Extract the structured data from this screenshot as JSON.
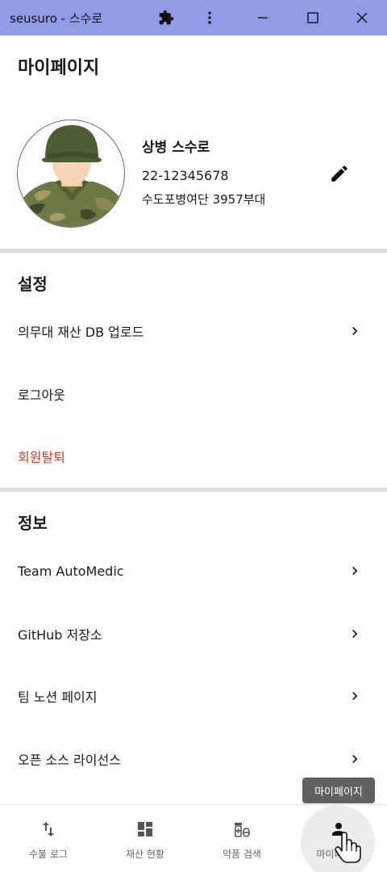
{
  "window": {
    "title": "seusuro - 스수로",
    "icons": [
      "extensions-icon",
      "more-vert-icon",
      "minimize-icon",
      "maximize-icon",
      "close-icon"
    ]
  },
  "page": {
    "title": "마이페이지"
  },
  "profile": {
    "rank_name": "상병 스수로",
    "serial": "22-12345678",
    "unit": "수도포병여단 3957부대"
  },
  "settings": {
    "title": "설정",
    "items": [
      {
        "label": "의무대 재산 DB 업로드",
        "chevron": true
      },
      {
        "label": "로그아웃",
        "chevron": false
      },
      {
        "label": "회원탈퇴",
        "chevron": false,
        "color": "#d33a2c"
      }
    ]
  },
  "info": {
    "title": "정보",
    "items": [
      {
        "label": "Team AutoMedic",
        "chevron": true
      },
      {
        "label": "GitHub 저장소",
        "chevron": true
      },
      {
        "label": "팀 노션 페이지",
        "chevron": true
      },
      {
        "label": "오픈 소스 라이선스",
        "chevron": true
      }
    ]
  },
  "tooltip": {
    "text": "마이페이지"
  },
  "bottom_nav": {
    "items": [
      {
        "label": "수불 로그",
        "icon": "swap-vert-icon"
      },
      {
        "label": "재산 현황",
        "icon": "dashboard-icon"
      },
      {
        "label": "약품 검색",
        "icon": "medication-icon"
      },
      {
        "label": "마이페이지",
        "icon": "person-icon",
        "active": true
      }
    ]
  },
  "colors": {
    "titlebar": "#8f9ce6",
    "danger": "#d33a2c",
    "divider": "#dcdcdc"
  }
}
